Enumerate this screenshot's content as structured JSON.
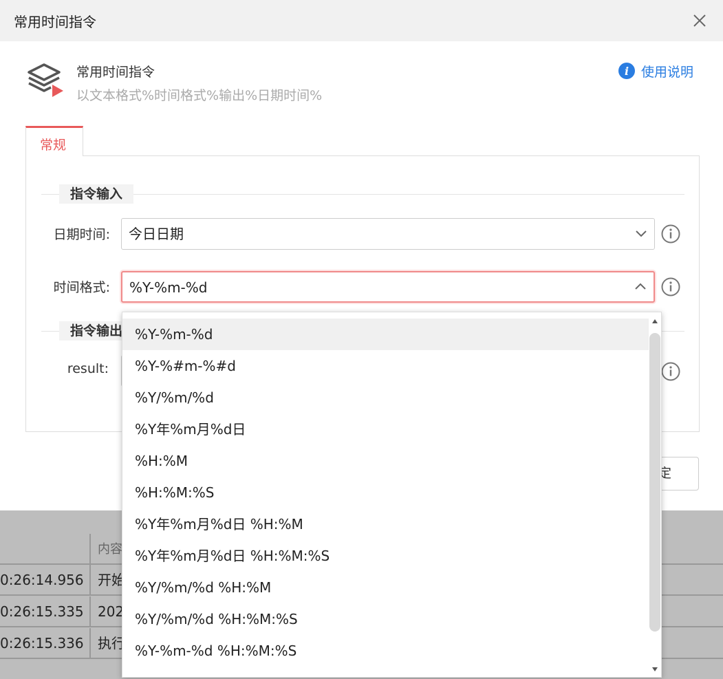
{
  "window": {
    "title": "常用时间指令"
  },
  "header": {
    "command_name": "常用时间指令",
    "command_desc": "以文本格式%时间格式%输出%日期时间%",
    "help_label": "使用说明"
  },
  "tabs": [
    {
      "label": "常规",
      "active": true
    }
  ],
  "sections": {
    "input": "指令输入",
    "output": "指令输出"
  },
  "fields": {
    "datetime": {
      "label": "日期时间:",
      "value": "今日日期"
    },
    "format": {
      "label": "时间格式:",
      "value": "%Y-%m-%d"
    },
    "result": {
      "label": "result:"
    }
  },
  "buttons": {
    "ok_partial": "定"
  },
  "dropdown": {
    "selected_index": 0,
    "options": [
      "%Y-%m-%d",
      "%Y-%#m-%#d",
      "%Y/%m/%d",
      "%Y年%m月%d日",
      "%H:%M",
      "%H:%M:%S",
      "%Y年%m月%d日 %H:%M",
      "%Y年%m月%d日 %H:%M:%S",
      "%Y/%m/%d %H:%M",
      "%Y/%m/%d %H:%M:%S",
      "%Y-%m-%d %H:%M:%S"
    ]
  },
  "log_table": {
    "header_content": "内容",
    "rows": [
      {
        "time": "0:26:14.956",
        "content": "开始"
      },
      {
        "time": "0:26:15.335",
        "content": "202"
      },
      {
        "time": "0:26:15.336",
        "content": "执行"
      }
    ]
  },
  "colors": {
    "accent": "#e8595a",
    "link": "#2a7de1"
  }
}
